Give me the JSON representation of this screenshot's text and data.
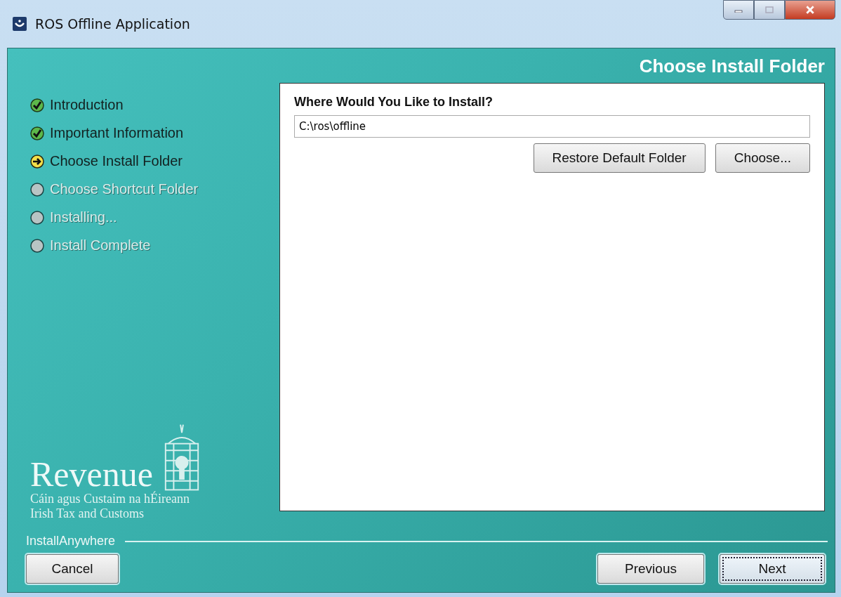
{
  "window": {
    "title": "ROS Offline Application"
  },
  "header": "Choose Install Folder",
  "steps": [
    {
      "label": "Introduction",
      "kind": "done"
    },
    {
      "label": "Important Information",
      "kind": "done"
    },
    {
      "label": "Choose Install Folder",
      "kind": "current"
    },
    {
      "label": "Choose Shortcut Folder",
      "kind": "pending"
    },
    {
      "label": "Installing...",
      "kind": "pending"
    },
    {
      "label": "Install Complete",
      "kind": "pending"
    }
  ],
  "logo": {
    "name": "Revenue",
    "line_1": "Cáin agus Custaim na hÉireann",
    "line_2": "Irish Tax and Customs"
  },
  "panel": {
    "prompt": "Where Would You Like to Install?",
    "path": "C:\\ros\\offline",
    "buttons": [
      "Restore Default Folder",
      "Choose..."
    ]
  },
  "footer": {
    "brand": "InstallAnywhere",
    "cancel": {
      "label": "Cancel",
      "focused": false
    },
    "nav": [
      {
        "label": "Previous",
        "focused": false
      },
      {
        "label": "Next",
        "focused": true
      }
    ]
  }
}
